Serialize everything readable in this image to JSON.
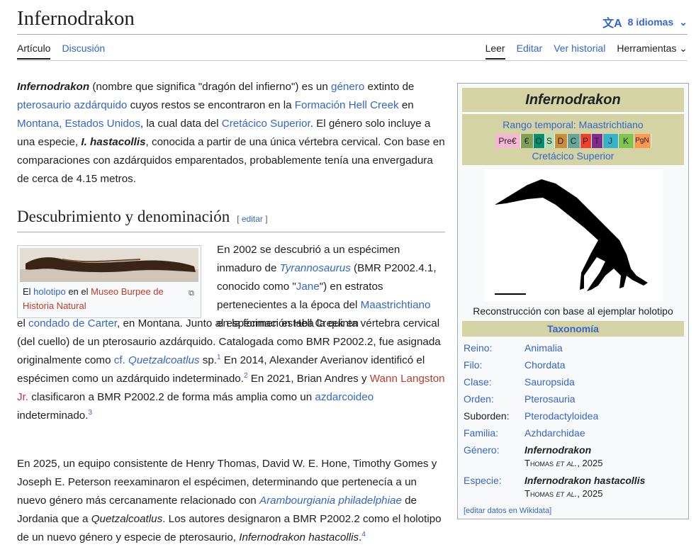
{
  "page": {
    "title": "Infernodrakon",
    "languages_label": "8 idiomas"
  },
  "tabs": {
    "left": [
      "Artículo",
      "Discusión"
    ],
    "right": [
      "Leer",
      "Editar",
      "Ver historial",
      "Herramientas"
    ]
  },
  "intro": {
    "name": "Infernodrakon",
    "t1": " (nombre que significa \"dragón del infierno\") es un ",
    "l1": "género",
    "t2": " extinto de ",
    "l2": "pterosaurio azdárquido",
    "t3": " cuyos restos se encontraron en la ",
    "l3": "Formación Hell Creek",
    "t4": " en ",
    "l4": "Montana, Estados Unidos",
    "t5": ", la cual data del ",
    "l5": "Cretácico Superior",
    "t6": ". El género solo incluye a una especie, ",
    "species": "I. hastacollis",
    "t7": ", conocida a partir de una única vértebra cervical. Con base en comparaciones con azdárquidos emparentados, probablemente tenía una envergadura de cerca de 4.15 metros."
  },
  "section": {
    "heading": "Descubrimiento y denominación",
    "edit_label": "editar",
    "thumb_caption": {
      "t1": "El ",
      "l1": "holotipo",
      "t2": " en el ",
      "l2": "Museo Burpee de Historia Natural"
    },
    "p1": {
      "t1": "En 2002 se descubrió a un espécimen inmaduro de ",
      "l1": "Tyrannosaurus",
      "t2": " (BMR P2002.4.1, conocido como \"",
      "l2": "Jane",
      "t3": "\") en estratos pertenecientes a la época del ",
      "l3": "Maastrichtiano",
      "t4": " en la formación Hell Creek en"
    },
    "p1b": {
      "t1": "el ",
      "l1": "condado de Carter",
      "t2": ", en Montana. Junto al espécimen estaba la quinta vértebra cervical (del cuello) de un pterosaurio azdárquido. Catalogada como BMR P2002.2, fue asignada originalmente como ",
      "l2": "cf.",
      "l3": "Quetzalcoatlus",
      "t3": " sp.",
      "r1": "1",
      "t4": "  En 2014, Alexander Averianov identificó el espécimen como un azdárquido indeterminado.",
      "r2": "2",
      "t5": "  En 2021, Brian Andres y ",
      "l4": "Wann Langston Jr.",
      "t6": " clasificaron a BMR P2002.2 de forma más amplia como un ",
      "l5": "azdarcoideo",
      "t7": " indeterminado.",
      "r3": "3"
    },
    "p2": {
      "t1": "En 2025, un equipo consistente de Henry Thomas, David W. E. Hone, Timothy Gomes y Joseph E. Peterson reexaminaron el espécimen, determinando que pertenecía a un nuevo género más cercanamente relacionado con ",
      "l1": "Arambourgiania philadelphiae",
      "t2": " de Jordania que a ",
      "i1": "Quetzalcoatlus",
      "t3": ". Los autores designaron a BMR P2002.2 como el holotipo de un nuevo género y especie de pterosaurio, ",
      "i2": "Infernodrakon hastacollis",
      "t4": ".",
      "r1": "4"
    }
  },
  "infobox": {
    "title": "Infernodrakon",
    "range": "Rango temporal: Maastrichtiano",
    "period": "Cretácico Superior",
    "timeline": [
      {
        "label": "Pre€",
        "color": "#f7b6d2",
        "w": 36
      },
      {
        "label": "€",
        "color": "#7fa056",
        "w": 18
      },
      {
        "label": "O",
        "color": "#009270",
        "w": 16
      },
      {
        "label": "S",
        "color": "#b3e1b6",
        "w": 14
      },
      {
        "label": "D",
        "color": "#cb8c37",
        "w": 18
      },
      {
        "label": "C",
        "color": "#67a599",
        "w": 18
      },
      {
        "label": "P",
        "color": "#f04028",
        "w": 16
      },
      {
        "label": "T",
        "color": "#812b92",
        "w": 16
      },
      {
        "label": "J",
        "color": "#34b2c9",
        "w": 22
      },
      {
        "label": "K",
        "color": "#7fc64e",
        "w": 22
      },
      {
        "label": "PgN",
        "color": "#fd9a52",
        "w": 24
      }
    ],
    "image_caption": "Reconstrucción con base al ejemplar holotipo",
    "taxonomy_label": "Taxonomía",
    "rows": [
      {
        "key": "Reino:",
        "value": "Animalia",
        "link_key": true
      },
      {
        "key": "Filo:",
        "value": "Chordata",
        "link_key": true
      },
      {
        "key": "Clase:",
        "value": "Sauropsida",
        "link_key": true
      },
      {
        "key": "Orden:",
        "value": "Pterosauria",
        "link_key": true
      },
      {
        "key": "Suborden:",
        "value": "Pterodactyloidea",
        "link_key": false
      },
      {
        "key": "Familia:",
        "value": "Azhdarchidae",
        "link_key": true
      }
    ],
    "genus_key": "Género:",
    "genus_value": "Infernodrakon",
    "genus_auth_name": "Thomas",
    "genus_auth_rest": " et al.",
    "genus_auth_year": ", 2025",
    "species_key": "Especie:",
    "species_value": "Infernodrakon hastacollis",
    "species_auth_name": "Thomas",
    "species_auth_rest": " et al.",
    "species_auth_year": ", 2025",
    "wikidata": "[editar datos en Wikidata]"
  }
}
